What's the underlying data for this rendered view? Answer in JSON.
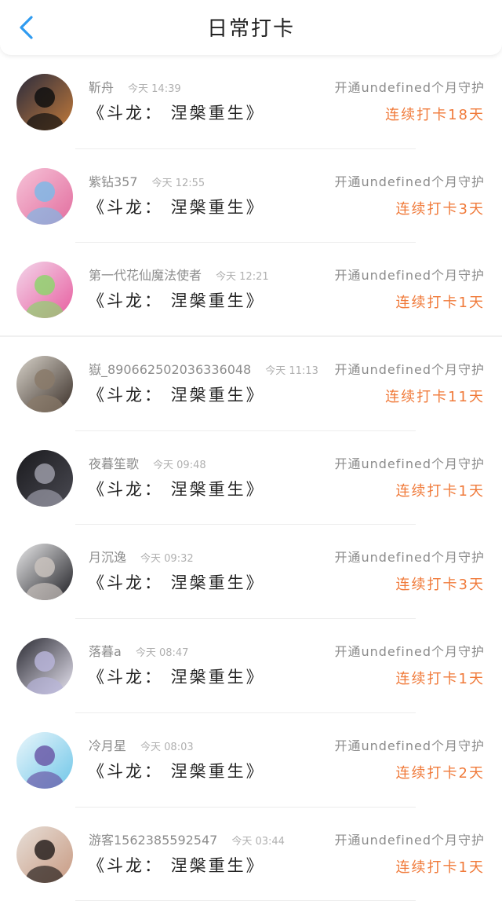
{
  "header": {
    "title": "日常打卡",
    "back_icon": "chevron-left-icon",
    "accent_color": "#2f9bf0"
  },
  "colors": {
    "streak": "#f07a3a",
    "secondary_text": "#8c8c8c"
  },
  "entries": [
    {
      "username": "靳舟",
      "time": "今天 14:39",
      "book": "《斗龙： 涅槃重生》",
      "guard": "开通undefined个月守护",
      "streak": "连续打卡18天",
      "avatar_colors": [
        "#2a2b3d",
        "#c27a3a",
        "#111111"
      ]
    },
    {
      "username": "紫钻357",
      "time": "今天 12:55",
      "book": "《斗龙： 涅槃重生》",
      "guard": "开通undefined个月守护",
      "streak": "连续打卡3天",
      "avatar_colors": [
        "#f6c3d8",
        "#e26d9e",
        "#7fb8e6"
      ]
    },
    {
      "username": "第一代花仙魔法使者",
      "time": "今天 12:21",
      "book": "《斗龙： 涅槃重生》",
      "guard": "开通undefined个月守护",
      "streak": "连续打卡1天",
      "avatar_colors": [
        "#f3d6ea",
        "#e75d9f",
        "#8fd36f"
      ]
    },
    {
      "username": "嶽_8906625020363360​48",
      "time": "今天 11:13",
      "book": "《斗龙： 涅槃重生》",
      "guard": "开通undefined个月守护",
      "streak": "连续打卡11天",
      "avatar_colors": [
        "#d7d2c9",
        "#3a2f28",
        "#8a7a6a"
      ]
    },
    {
      "username": "夜暮笙歌",
      "time": "今天 09:48",
      "book": "《斗龙： 涅槃重生》",
      "guard": "开通undefined个月守护",
      "streak": "连续打卡1天",
      "avatar_colors": [
        "#1a1a1e",
        "#4a4a52",
        "#9a9aa6"
      ]
    },
    {
      "username": "月沉逸",
      "time": "今天 09:32",
      "book": "《斗龙： 涅槃重生》",
      "guard": "开通undefined个月守护",
      "streak": "连续打卡3天",
      "avatar_colors": [
        "#e9e9ea",
        "#1d1d22",
        "#c9c2bd"
      ]
    },
    {
      "username": "落暮a",
      "time": "今天 08:47",
      "book": "《斗龙： 涅槃重生》",
      "guard": "开通undefined个月守护",
      "streak": "连续打卡1天",
      "avatar_colors": [
        "#2b2b33",
        "#e6e3f0",
        "#b7b4d8"
      ]
    },
    {
      "username": "冷月星",
      "time": "今天 08:03",
      "book": "《斗龙： 涅槃重生》",
      "guard": "开通undefined个月守护",
      "streak": "连续打卡2天",
      "avatar_colors": [
        "#eaf6fb",
        "#6fc6e8",
        "#6b5aa8"
      ]
    },
    {
      "username": "游客15623855925​47",
      "time": "今天 03:44",
      "book": "《斗龙： 涅槃重生》",
      "guard": "开通undefined个月守护",
      "streak": "连续打卡1天",
      "avatar_colors": [
        "#e7dfd8",
        "#c89a82",
        "#2a2220"
      ]
    }
  ]
}
